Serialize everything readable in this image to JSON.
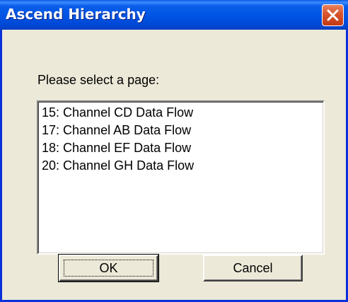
{
  "window": {
    "title": "Ascend Hierarchy"
  },
  "dialog": {
    "prompt": "Please select a page:",
    "pages": [
      "15: Channel CD Data Flow",
      "17: Channel AB Data Flow",
      "18: Channel EF Data Flow",
      "20: Channel GH Data Flow"
    ],
    "ok_label": "OK",
    "cancel_label": "Cancel"
  },
  "icons": {
    "close": "close-icon"
  },
  "colors": {
    "titlebar": "#0055e5",
    "close_button": "#d8532c",
    "dialog_background": "#ece9d8",
    "list_background": "#ffffff"
  }
}
